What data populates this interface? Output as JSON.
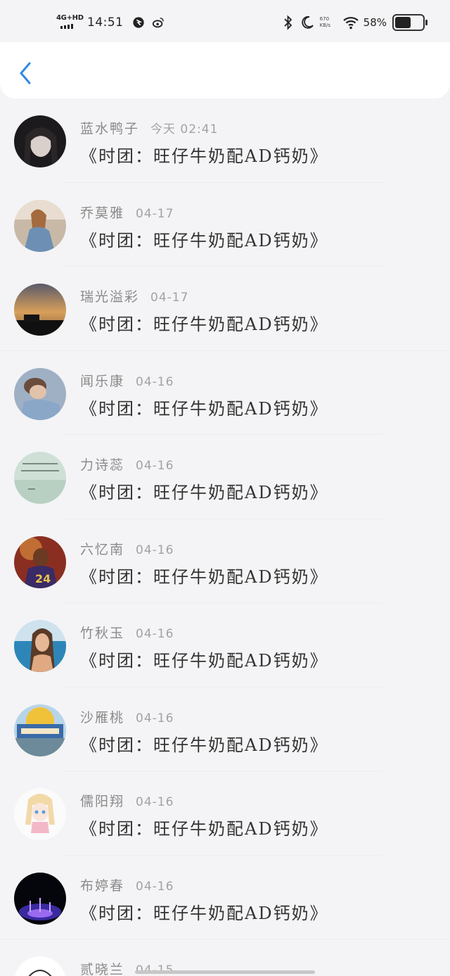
{
  "status_bar": {
    "network": "4G+HD",
    "time": "14:51",
    "net_speed": "670\nKB/s",
    "battery_percent": "58%",
    "battery_level": 0.58
  },
  "header": {
    "back_icon": "chevron-left-icon",
    "accent_color": "#2f8ae4"
  },
  "comments": [
    {
      "name": "蓝水鸭子",
      "time": "今天 02:41",
      "text": "《时团：旺仔牛奶配AD钙奶》"
    },
    {
      "name": "乔莫雅",
      "time": "04-17",
      "text": "《时团：旺仔牛奶配AD钙奶》"
    },
    {
      "name": "瑞光溢彩",
      "time": "04-17",
      "text": "《时团：旺仔牛奶配AD钙奶》"
    },
    {
      "name": "闻乐康",
      "time": "04-16",
      "text": "《时团：旺仔牛奶配AD钙奶》"
    },
    {
      "name": "力诗蕊",
      "time": "04-16",
      "text": "《时团：旺仔牛奶配AD钙奶》"
    },
    {
      "name": "六忆南",
      "time": "04-16",
      "text": "《时团：旺仔牛奶配AD钙奶》"
    },
    {
      "name": "竹秋玉",
      "time": "04-16",
      "text": "《时团：旺仔牛奶配AD钙奶》"
    },
    {
      "name": "沙雁桃",
      "time": "04-16",
      "text": "《时团：旺仔牛奶配AD钙奶》"
    },
    {
      "name": "儒阳翔",
      "time": "04-16",
      "text": "《时团：旺仔牛奶配AD钙奶》"
    },
    {
      "name": "布婷春",
      "time": "04-16",
      "text": "《时团：旺仔牛奶配AD钙奶》"
    },
    {
      "name": "贰晓兰",
      "time": "04-15",
      "text": ""
    }
  ]
}
